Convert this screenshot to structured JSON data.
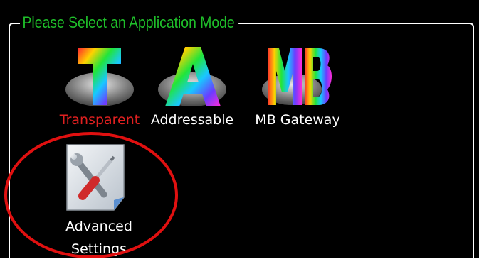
{
  "group_title": "Please Select an Application Mode",
  "modes": [
    {
      "label": "Transparent",
      "icon": "t-logo-icon",
      "active": true,
      "label_color": "#e02020"
    },
    {
      "label": "Addressable",
      "icon": "a-logo-icon"
    },
    {
      "label": "MB Gateway",
      "icon": "mb-logo-icon"
    }
  ],
  "advanced": {
    "line1": "Advanced",
    "line2": "Settings",
    "icon": "settings-tools-icon"
  },
  "colors": {
    "background": "#000000",
    "title": "#1fbf2a",
    "selected_label": "#e02020",
    "annotation": "#e01010"
  }
}
